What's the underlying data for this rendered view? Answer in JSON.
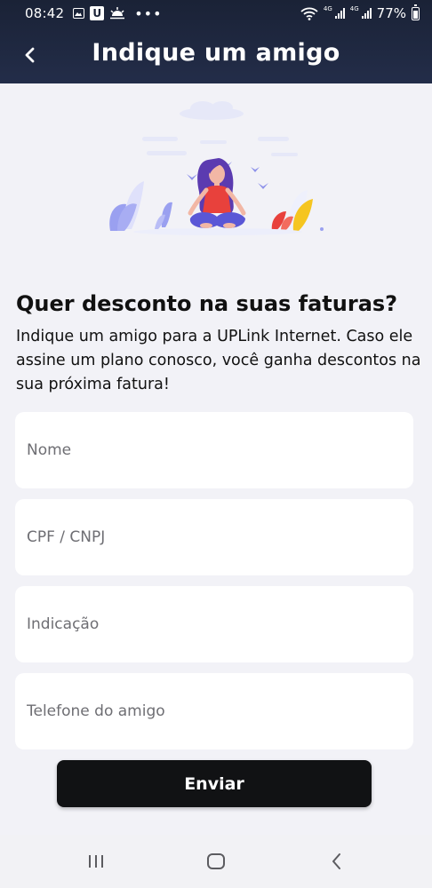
{
  "status_bar": {
    "time": "08:42",
    "battery": "77%",
    "network": "4G",
    "icons": [
      "gallery-icon",
      "u-app-icon",
      "weather-icon",
      "more-dots-icon",
      "wifi-icon",
      "signal-icon",
      "battery-icon"
    ]
  },
  "header": {
    "title": "Indique um amigo",
    "back_icon": "chevron-left-icon"
  },
  "illustration": {
    "name": "meditating-woman-illustration",
    "colors": {
      "hair": "#5b3bb0",
      "shirt": "#e8413c",
      "pants": "#5a57d6",
      "plants_blue": "#9aa0f0",
      "plants_red": "#e8413c",
      "plants_yellow": "#f5c520"
    }
  },
  "main": {
    "heading": "Quer desconto na suas faturas?",
    "description": "Indique um amigo para a UPLink Internet. Caso ele assine um plano conosco, você ganha descontos na sua próxima fatura!"
  },
  "form": {
    "name_placeholder": "Nome",
    "document_placeholder": "CPF / CNPJ",
    "referral_placeholder": "Indicação",
    "phone_placeholder": "Telefone do amigo",
    "submit_label": "Enviar"
  },
  "navigation_bar": {
    "icons": [
      "recent-apps-icon",
      "home-icon",
      "back-icon"
    ]
  },
  "colors": {
    "header_bg": "#1e2740",
    "page_bg": "#f2f2f7",
    "button_bg": "#111214",
    "field_bg": "#ffffff"
  }
}
